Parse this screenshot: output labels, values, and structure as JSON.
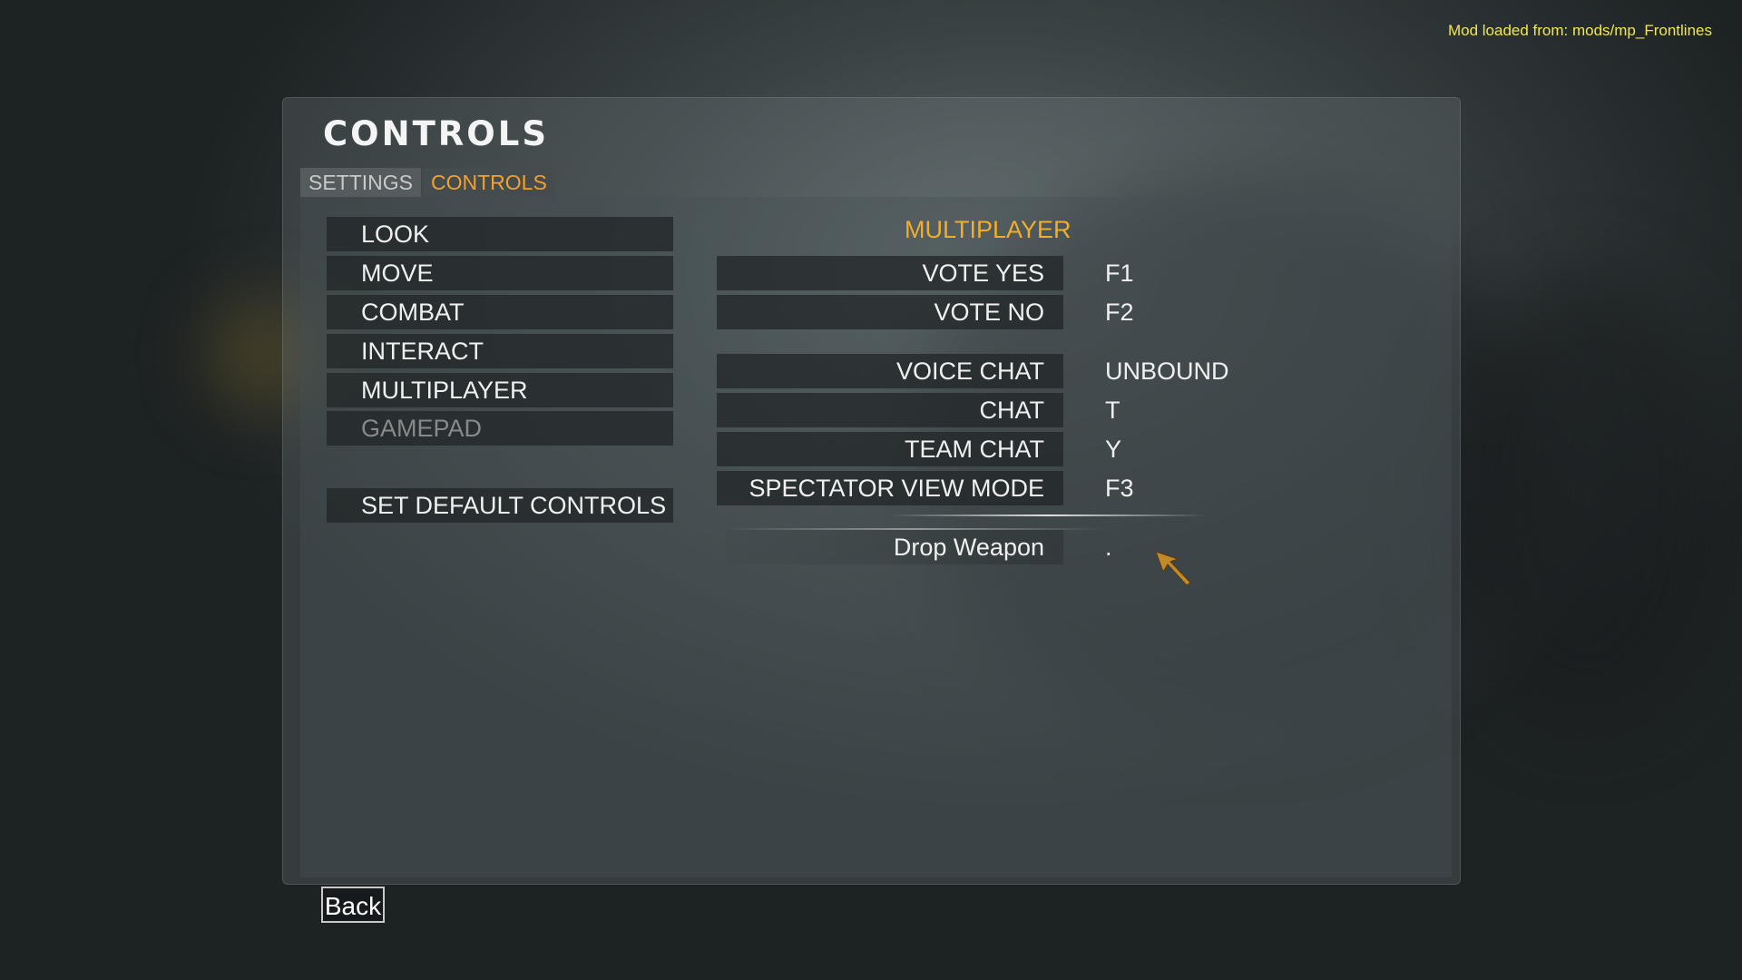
{
  "mod_message": "Mod loaded from: mods/mp_Frontlines",
  "title": "CONTROLS",
  "tabs": [
    {
      "label": "SETTINGS"
    },
    {
      "label": "CONTROLS"
    }
  ],
  "categories": [
    {
      "label": "LOOK"
    },
    {
      "label": "MOVE"
    },
    {
      "label": "COMBAT"
    },
    {
      "label": "INTERACT"
    },
    {
      "label": "MULTIPLAYER"
    },
    {
      "label": "GAMEPAD"
    }
  ],
  "set_default_label": "SET DEFAULT CONTROLS",
  "section_title": "MULTIPLAYER",
  "bindings": [
    {
      "action": "VOTE YES",
      "key": "F1"
    },
    {
      "action": "VOTE NO",
      "key": "F2"
    },
    {
      "action": "VOICE CHAT",
      "key": "UNBOUND"
    },
    {
      "action": "CHAT",
      "key": "T"
    },
    {
      "action": "TEAM CHAT",
      "key": "Y"
    },
    {
      "action": "SPECTATOR VIEW MODE",
      "key": "F3"
    },
    {
      "action": "Drop Weapon",
      "key": "."
    }
  ],
  "back_label": "Back",
  "colors": {
    "accent": "#f2ad2b",
    "tab_active": "#f2a030",
    "mod_text": "#f2e64a"
  }
}
